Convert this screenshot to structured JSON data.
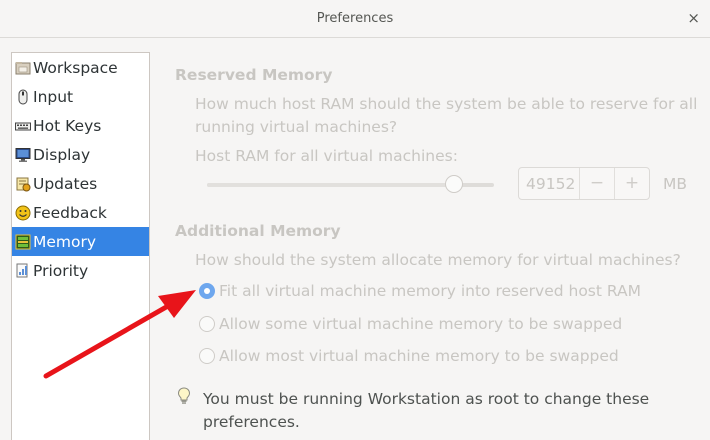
{
  "window": {
    "title": "Preferences",
    "close_glyph": "×"
  },
  "sidebar": {
    "items": [
      {
        "label": "Workspace",
        "icon": "folder-icon"
      },
      {
        "label": "Input",
        "icon": "mouse-icon"
      },
      {
        "label": "Hot Keys",
        "icon": "keyboard-icon"
      },
      {
        "label": "Display",
        "icon": "monitor-icon"
      },
      {
        "label": "Updates",
        "icon": "updates-icon"
      },
      {
        "label": "Feedback",
        "icon": "smiley-icon"
      },
      {
        "label": "Memory",
        "icon": "memory-chip-icon",
        "selected": true
      },
      {
        "label": "Priority",
        "icon": "priority-icon"
      }
    ]
  },
  "reserved": {
    "heading": "Reserved Memory",
    "question_line1": "How much host RAM should the system be able to reserve for all",
    "question_line2": "running virtual machines?",
    "slider_label": "Host RAM for all virtual machines:",
    "slider_level": 0.86,
    "value": "49152",
    "minus": "−",
    "plus": "+",
    "unit": "MB"
  },
  "additional": {
    "heading": "Additional Memory",
    "question": "How should the system allocate memory for virtual machines?",
    "options": [
      {
        "label": "Fit all virtual machine memory into reserved host RAM",
        "selected": true
      },
      {
        "label": "Allow some virtual machine memory to be swapped",
        "selected": false
      },
      {
        "label": "Allow most virtual machine memory to be swapped",
        "selected": false
      }
    ]
  },
  "note": {
    "line1": "You must be running Workstation as root to change these",
    "line2": "preferences."
  },
  "colors": {
    "accent": "#3584e4",
    "annotation_arrow": "#e8141a"
  }
}
